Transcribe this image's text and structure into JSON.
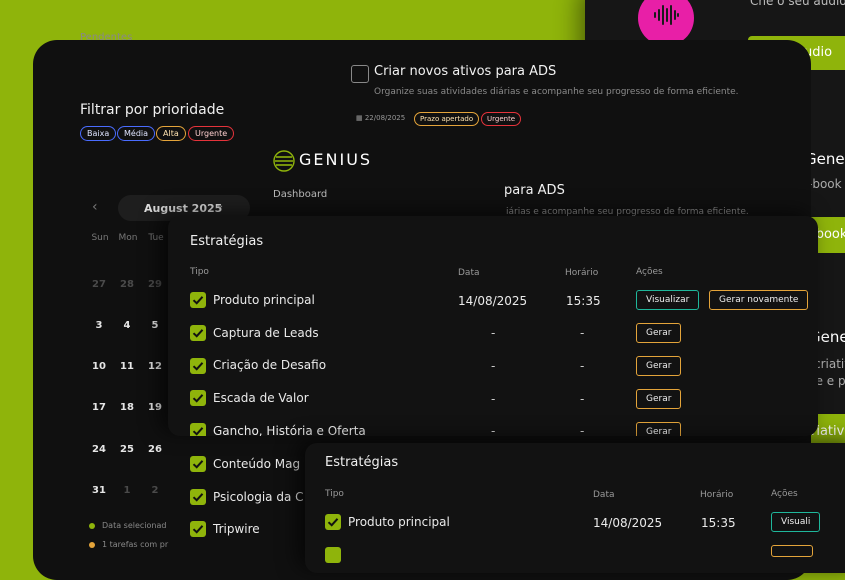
{
  "right_panel": {
    "audio_question": "Che o seu áudio pe",
    "audio_button": "udio",
    "section1_title": "Gene",
    "section1_sub": "-book p",
    "section1_button": "-book",
    "section2_title": "Gene",
    "section2_sub1": "criativ",
    "section2_sub2": "ue e pe",
    "section2_button": "riativo",
    "accent_color": "#8fb40b",
    "audio_icon_color": "#e81fa7"
  },
  "filter": {
    "pendentes_label": "Pendentes",
    "title": "Filtrar por prioridade",
    "pills": [
      "Baixa",
      "Média",
      "Alta",
      "Urgente"
    ]
  },
  "task": {
    "title": "Criar novos ativos para ADS",
    "description": "Organize suas atividades diárias e acompanhe seu progresso de forma eficiente.",
    "date": "22/08/2025",
    "tags": [
      "Prazo apertado",
      "Urgente"
    ]
  },
  "task2": {
    "title": "para ADS",
    "description": "iárias e acompanhe seu progresso de forma eficiente."
  },
  "calendar": {
    "month": "August 2025",
    "weekdays": [
      "Sun",
      "Mon",
      "Tue"
    ],
    "weeks": [
      [
        "27",
        "28",
        "29"
      ],
      [
        "3",
        "4",
        "5"
      ],
      [
        "10",
        "11",
        "12"
      ],
      [
        "17",
        "18",
        "19"
      ],
      [
        "24",
        "25",
        "26"
      ],
      [
        "31",
        "1",
        "2"
      ]
    ],
    "legend": [
      "Data selecionad",
      "1 tarefas com pr"
    ]
  },
  "sidebar": {
    "logo_text": "GENIUS",
    "dashboard_label": "Dashboard"
  },
  "strategies": {
    "title": "Estratégias",
    "columns": {
      "type": "Tipo",
      "date": "Data",
      "time": "Horário",
      "actions": "Ações"
    },
    "rows": [
      {
        "label": "Produto principal",
        "date": "14/08/2025",
        "time": "15:35",
        "actions": [
          "Visualizar",
          "Gerar novamente"
        ]
      },
      {
        "label": "Captura de Leads",
        "date": "-",
        "time": "-",
        "actions": [
          "Gerar"
        ]
      },
      {
        "label": "Criação de Desafio",
        "date": "-",
        "time": "-",
        "actions": [
          "Gerar"
        ]
      },
      {
        "label": "Escada de Valor",
        "date": "-",
        "time": "-",
        "actions": [
          "Gerar"
        ]
      },
      {
        "label": "Gancho, História e Oferta",
        "date": "-",
        "time": "-",
        "actions": [
          "Gerar"
        ]
      },
      {
        "label": "Conteúdo Mag"
      },
      {
        "label": "Psicologia da C"
      },
      {
        "label": "Tripwire"
      }
    ]
  },
  "strategies2": {
    "title": "Estratégias",
    "columns": {
      "type": "Tipo",
      "date": "Data",
      "time": "Horário",
      "actions": "Ações"
    },
    "rows": [
      {
        "label": "Produto principal",
        "date": "14/08/2025",
        "time": "15:35",
        "action": "Visuali"
      }
    ]
  }
}
